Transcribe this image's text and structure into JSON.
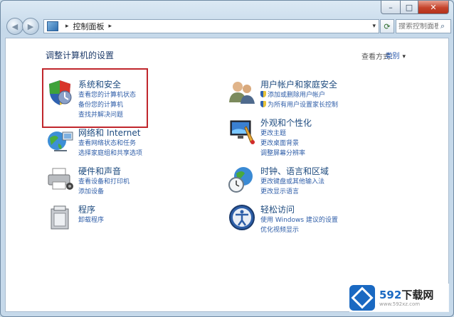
{
  "window": {
    "buttons": {
      "minimize": "–",
      "maximize": "□",
      "close": "✕"
    }
  },
  "nav": {
    "back_glyph": "◀",
    "forward_glyph": "▶",
    "breadcrumb": "控制面板",
    "breadcrumb_sep": "▸",
    "address_dropdown": "▾",
    "refresh_glyph": "⟳",
    "search_placeholder": "搜索控制面板",
    "search_icon": "⌕"
  },
  "page": {
    "heading": "调整计算机的设置",
    "view_by_label": "查看方式：",
    "view_by_value": "类别"
  },
  "categories": [
    {
      "id": "system-security",
      "title": "系统和安全",
      "icon": "shield-icon",
      "links": [
        "查看您的计算机状态",
        "备份您的计算机",
        "查找并解决问题"
      ]
    },
    {
      "id": "network",
      "title": "网络和 Internet",
      "icon": "network-globe-icon",
      "links": [
        "查看网络状态和任务",
        "选择家庭组和共享选项"
      ]
    },
    {
      "id": "hardware",
      "title": "硬件和声音",
      "icon": "printer-icon",
      "links": [
        "查看设备和打印机",
        "添加设备"
      ]
    },
    {
      "id": "programs",
      "title": "程序",
      "icon": "program-box-icon",
      "links": [
        "卸载程序"
      ]
    },
    {
      "id": "user-accounts",
      "title": "用户帐户和家庭安全",
      "icon": "users-icon",
      "links": [
        "添加或删除用户帐户",
        "为所有用户设置家长控制"
      ]
    },
    {
      "id": "appearance",
      "title": "外观和个性化",
      "icon": "monitor-paint-icon",
      "links": [
        "更改主题",
        "更改桌面背景",
        "调整屏幕分辨率"
      ]
    },
    {
      "id": "clock",
      "title": "时钟、语言和区域",
      "icon": "clock-globe-icon",
      "links": [
        "更改键盘或其他输入法",
        "更改显示语言"
      ]
    },
    {
      "id": "ease",
      "title": "轻松访问",
      "icon": "ease-of-access-icon",
      "links": [
        "使用 Windows 建议的设置",
        "优化视频显示"
      ]
    }
  ],
  "watermark": {
    "brand_num": "592",
    "brand_text": "下载网",
    "url": "www.592xz.com"
  },
  "colors": {
    "highlight": "#c0262c",
    "link": "#2f5ea8",
    "title": "#1e4b7f"
  }
}
